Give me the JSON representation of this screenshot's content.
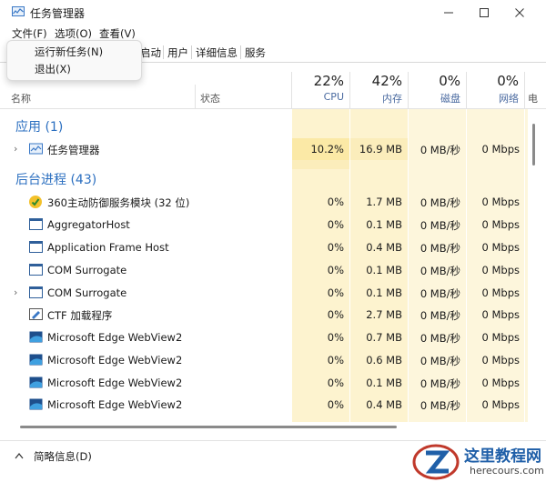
{
  "window": {
    "title": "任务管理器"
  },
  "menu": {
    "file": "文件(F)",
    "options": "选项(O)",
    "view": "查看(V)"
  },
  "file_menu": {
    "run_new_task": "运行新任务(N)",
    "exit": "退出(X)"
  },
  "tabs": {
    "startup_partial": "启动",
    "users": "用户",
    "details": "详细信息",
    "services": "服务"
  },
  "columns": {
    "name": "名称",
    "status": "状态",
    "cpu": {
      "pct": "22%",
      "label": "CPU"
    },
    "memory": {
      "pct": "42%",
      "label": "内存"
    },
    "disk": {
      "pct": "0%",
      "label": "磁盘"
    },
    "network": {
      "pct": "0%",
      "label": "网络"
    },
    "power_partial": "电"
  },
  "groups": {
    "apps": "应用 (1)",
    "background": "后台进程 (43)"
  },
  "rows": [
    {
      "name": "任务管理器",
      "cpu": "10.2%",
      "mem": "16.9 MB",
      "disk": "0 MB/秒",
      "net": "0 Mbps"
    },
    {
      "name": "360主动防御服务模块 (32 位)",
      "cpu": "0%",
      "mem": "1.7 MB",
      "disk": "0 MB/秒",
      "net": "0 Mbps"
    },
    {
      "name": "AggregatorHost",
      "cpu": "0%",
      "mem": "0.1 MB",
      "disk": "0 MB/秒",
      "net": "0 Mbps"
    },
    {
      "name": "Application Frame Host",
      "cpu": "0%",
      "mem": "0.4 MB",
      "disk": "0 MB/秒",
      "net": "0 Mbps"
    },
    {
      "name": "COM Surrogate",
      "cpu": "0%",
      "mem": "0.1 MB",
      "disk": "0 MB/秒",
      "net": "0 Mbps"
    },
    {
      "name": "COM Surrogate",
      "cpu": "0%",
      "mem": "0.1 MB",
      "disk": "0 MB/秒",
      "net": "0 Mbps"
    },
    {
      "name": "CTF 加载程序",
      "cpu": "0%",
      "mem": "2.7 MB",
      "disk": "0 MB/秒",
      "net": "0 Mbps"
    },
    {
      "name": "Microsoft Edge WebView2",
      "cpu": "0%",
      "mem": "0.7 MB",
      "disk": "0 MB/秒",
      "net": "0 Mbps"
    },
    {
      "name": "Microsoft Edge WebView2",
      "cpu": "0%",
      "mem": "0.6 MB",
      "disk": "0 MB/秒",
      "net": "0 Mbps"
    },
    {
      "name": "Microsoft Edge WebView2",
      "cpu": "0%",
      "mem": "0.1 MB",
      "disk": "0 MB/秒",
      "net": "0 Mbps"
    },
    {
      "name": "Microsoft Edge WebView2",
      "cpu": "0%",
      "mem": "0.4 MB",
      "disk": "0 MB/秒",
      "net": "0 Mbps"
    }
  ],
  "footer": {
    "fewer_details": "简略信息(D)"
  },
  "watermark": {
    "title": "这里教程网",
    "url": "herecours.com"
  },
  "colors": {
    "cpu_high": "#fbe9a6",
    "cell_light": "#fdf3cf",
    "group": "#2b6fc0",
    "accent_label": "#4a6aa0"
  }
}
